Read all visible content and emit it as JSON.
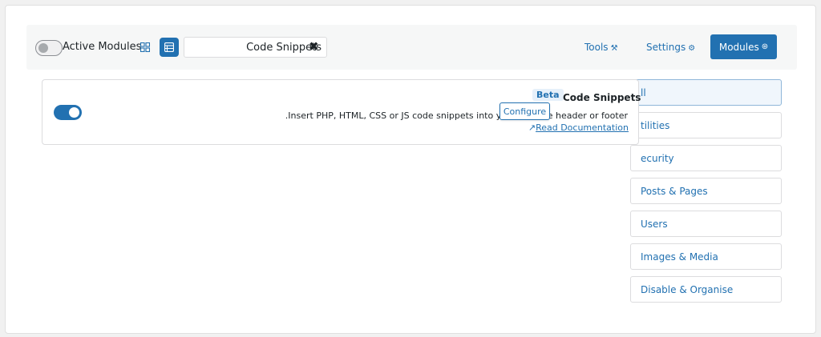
{
  "header": {
    "active_modules_label": "Active Modules",
    "search": {
      "value": "Code Snippets",
      "clear_icon": "close-icon"
    },
    "nav": {
      "tools_label": "Tools",
      "settings_label": "Settings",
      "modules_label": "Modules"
    }
  },
  "categories": [
    {
      "label": "ll",
      "active": true
    },
    {
      "label": "tilities",
      "active": false
    },
    {
      "label": "ecurity",
      "active": false
    },
    {
      "label": "Posts & Pages",
      "active": false
    },
    {
      "label": "Users",
      "active": false
    },
    {
      "label": "Images & Media",
      "active": false
    },
    {
      "label": "Disable & Organise",
      "active": false
    }
  ],
  "module": {
    "enabled": true,
    "badge": "Beta",
    "title": "Code Snippets",
    "description": ".Insert PHP, HTML, CSS or JS code snippets into your website header or footer",
    "doc_link": "Read Documentation",
    "configure_label": "Configure"
  },
  "colors": {
    "accent": "#2271b1"
  }
}
